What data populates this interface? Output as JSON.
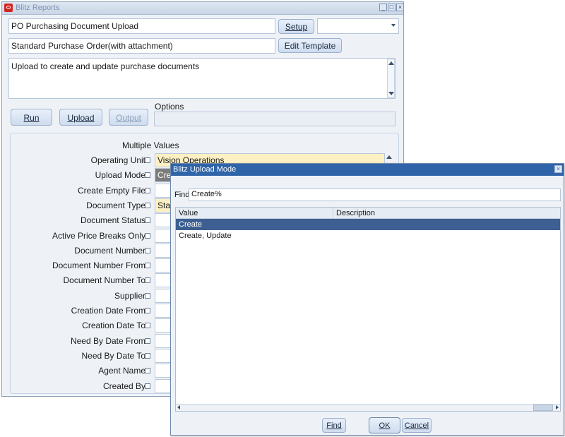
{
  "window": {
    "title": "Blitz Reports",
    "minimize": "_",
    "maximize": "□",
    "close": "×"
  },
  "report": {
    "name": "PO Purchasing Document Upload",
    "template": "Standard Purchase Order(with attachment)",
    "description": "Upload to create and update purchase documents"
  },
  "buttons": {
    "setup": "Setup",
    "edit_template": "Edit Template",
    "run": "Run",
    "upload": "Upload",
    "output": "Output"
  },
  "options_label": "Options",
  "multiple_values_label": "Multiple Values",
  "parameters": [
    {
      "label": "Operating Unit",
      "value": "Vision Operations"
    },
    {
      "label": "Upload Mode",
      "value": "Cre"
    },
    {
      "label": "Create Empty File",
      "value": ""
    },
    {
      "label": "Document Type",
      "value": "Star"
    },
    {
      "label": "Document Status",
      "value": ""
    },
    {
      "label": "Active Price Breaks Only",
      "value": ""
    },
    {
      "label": "Document Number",
      "value": ""
    },
    {
      "label": "Document Number From",
      "value": ""
    },
    {
      "label": "Document Number To",
      "value": ""
    },
    {
      "label": "Supplier",
      "value": ""
    },
    {
      "label": "Creation Date From",
      "value": ""
    },
    {
      "label": "Creation Date To",
      "value": ""
    },
    {
      "label": "Need By Date From",
      "value": ""
    },
    {
      "label": "Need By Date To",
      "value": ""
    },
    {
      "label": "Agent Name",
      "value": ""
    },
    {
      "label": "Created By",
      "value": ""
    }
  ],
  "dialog": {
    "title": "Blitz Upload Mode",
    "close": "×",
    "find_label": "Find",
    "find_value": "Create%",
    "columns": [
      "Value",
      "Description"
    ],
    "rows": [
      {
        "value": "Create",
        "description": "",
        "selected": true
      },
      {
        "value": "Create, Update",
        "description": "",
        "selected": false
      }
    ],
    "find_button": "Find",
    "ok_button": "OK",
    "cancel_button": "Cancel"
  },
  "colors": {
    "title_bar_active": "#2f64a8",
    "selected_row": "#3d5f91",
    "highlight_field": "#fdf1c4"
  }
}
